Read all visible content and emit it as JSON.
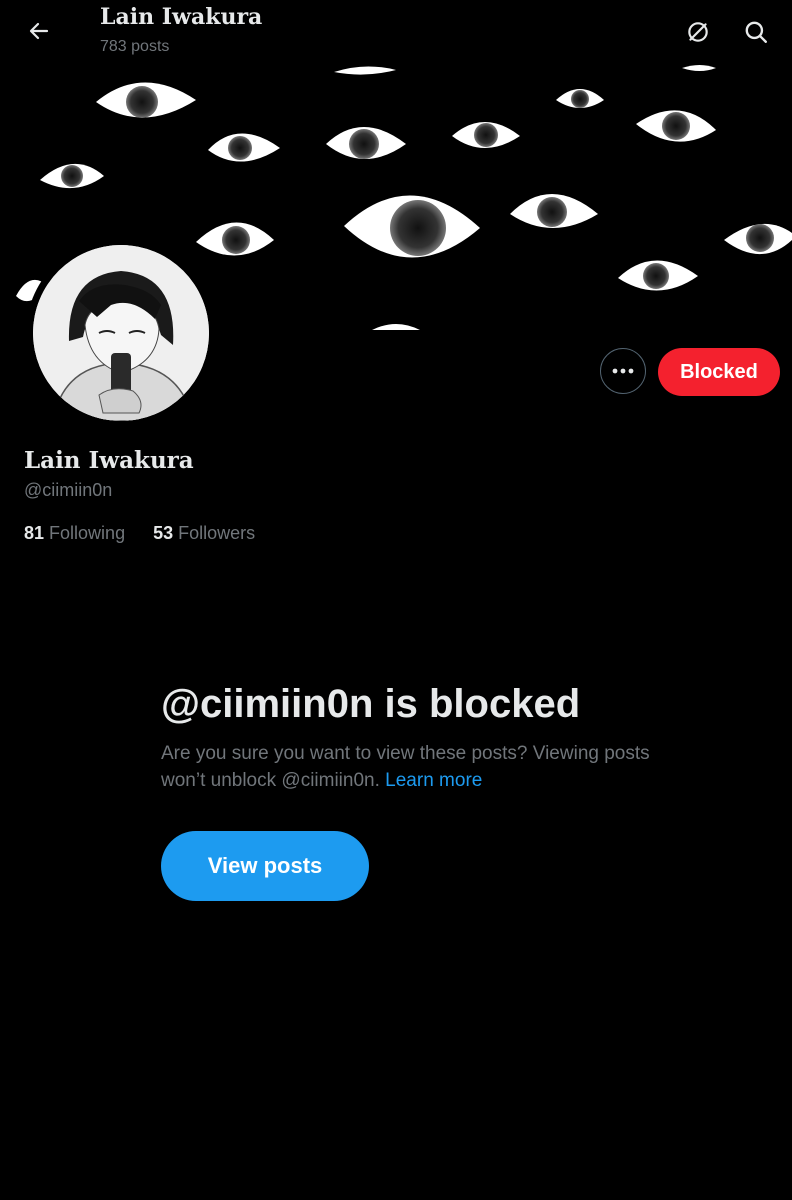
{
  "header": {
    "title": "Lain Iwakura",
    "post_count": "783 posts",
    "back_icon": "back-arrow-icon",
    "sync_icon": "sync-icon",
    "search_icon": "search-icon"
  },
  "profile": {
    "display_name": "Lain Iwakura",
    "handle": "@ciimiin0n",
    "following_count": "81",
    "following_label": "Following",
    "followers_count": "53",
    "followers_label": "Followers",
    "blocked_button_label": "Blocked",
    "more_icon": "more-options-icon"
  },
  "blocked_notice": {
    "title": "@ciimiin0n is blocked",
    "description": "Are you sure you want to view these posts? Viewing posts won’t unblock @ciimiin0n.",
    "learn_more": "Learn more",
    "view_posts_label": "View posts"
  },
  "colors": {
    "background": "#000000",
    "primary_text": "#e7e9ea",
    "secondary_text": "#71767b",
    "accent_blue": "#1d9bf0",
    "blocked_red": "#f4212e"
  }
}
